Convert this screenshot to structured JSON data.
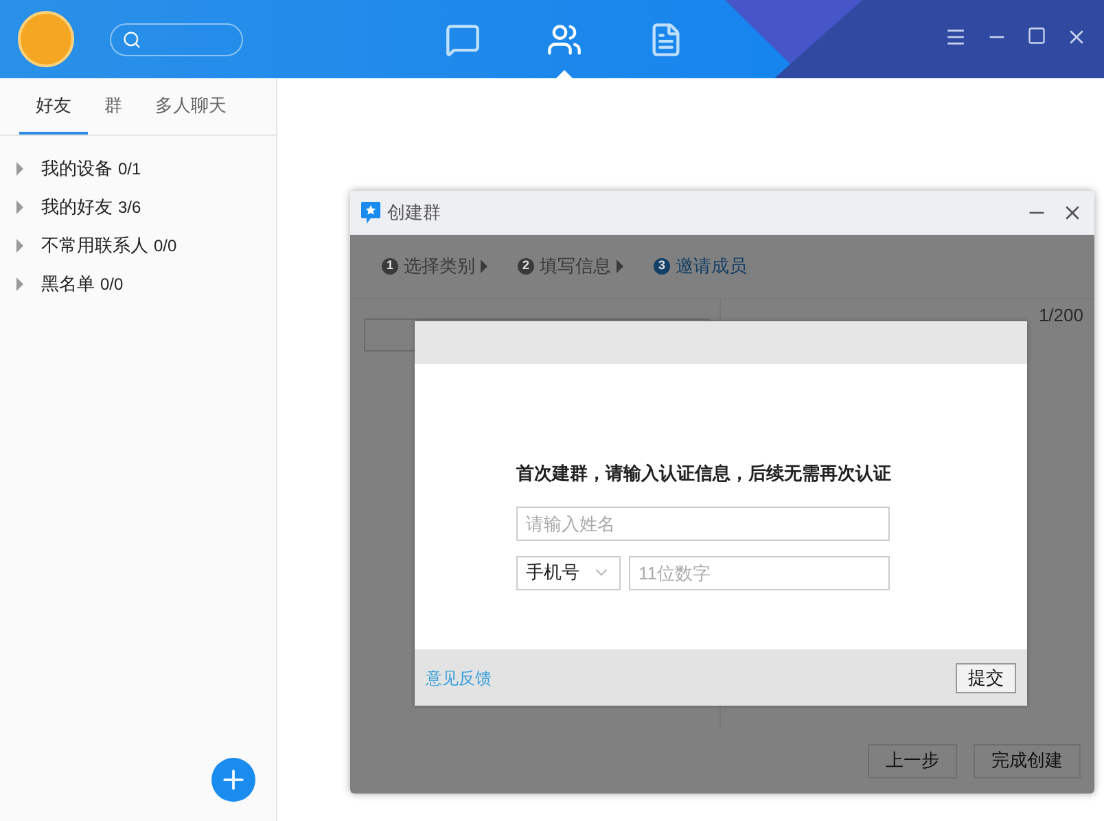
{
  "header": {
    "nav": [
      {
        "kind": "chat",
        "selected": false
      },
      {
        "kind": "contacts",
        "selected": true
      },
      {
        "kind": "docs",
        "selected": false
      }
    ]
  },
  "sidebar": {
    "tabs": [
      {
        "label": "好友",
        "selected": true
      },
      {
        "label": "群",
        "selected": false
      },
      {
        "label": "多人聊天",
        "selected": false
      }
    ],
    "groups": [
      {
        "name": "我的设备",
        "count": "0/1"
      },
      {
        "name": "我的好友",
        "count": "3/6"
      },
      {
        "name": "不常用联系人",
        "count": "0/0"
      },
      {
        "name": "黑名单",
        "count": "0/0"
      }
    ]
  },
  "create_group": {
    "title": "创建群",
    "steps": [
      {
        "number": "1",
        "label": "选择类别",
        "selected": false
      },
      {
        "number": "2",
        "label": "填写信息",
        "selected": false
      },
      {
        "number": "3",
        "label": "邀请成员",
        "selected": true
      }
    ],
    "selected_count": "1/200",
    "buttons": [
      "上一步",
      "完成创建"
    ]
  },
  "verify_dialog": {
    "message": "首次建群，请输入认证信息，后续无需再次认证",
    "name_field": {
      "placeholder": "请输入姓名"
    },
    "id_type": {
      "value": "手机号"
    },
    "phone_field": {
      "placeholder": "11位数字"
    },
    "feedback_link": "意见反馈",
    "submit": "提交"
  }
}
